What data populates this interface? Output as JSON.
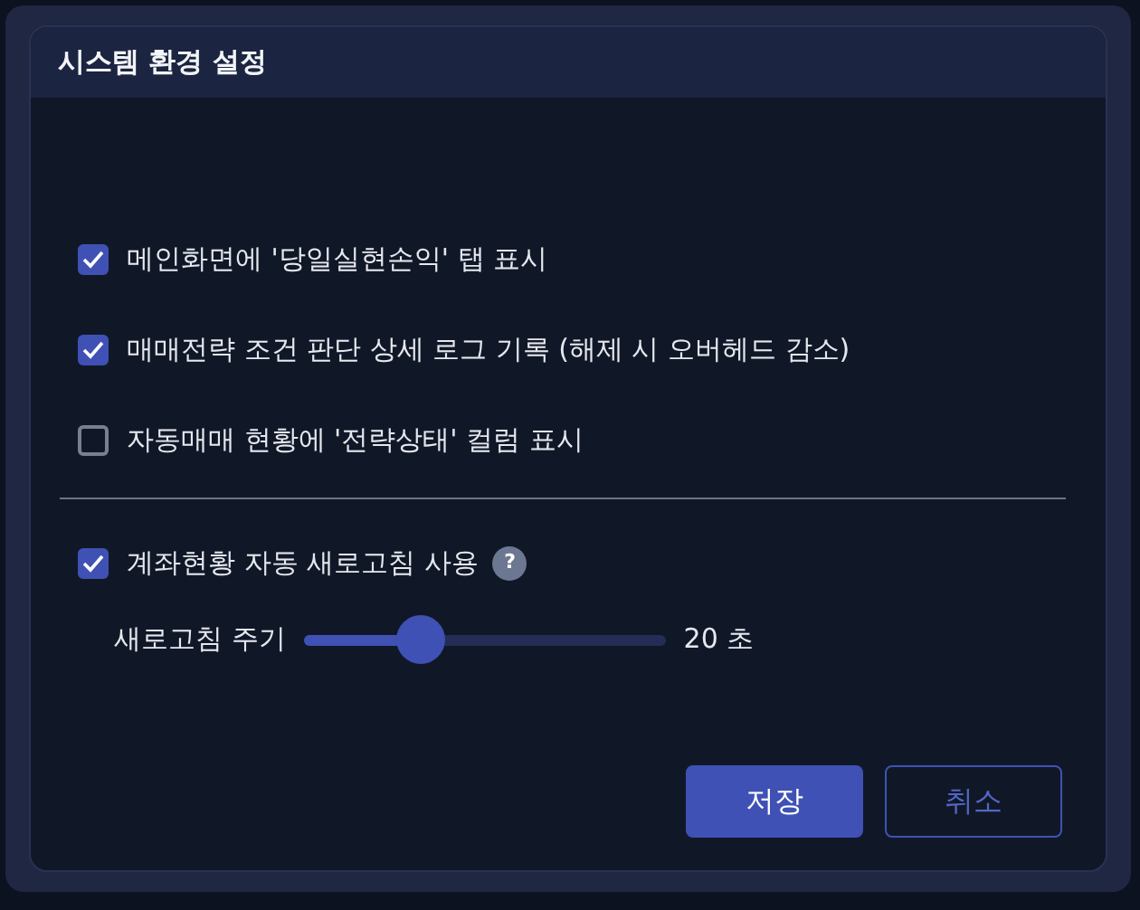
{
  "dialog": {
    "title": "시스템 환경 설정"
  },
  "options": [
    {
      "label": "메인화면에 '당일실현손익' 탭 표시",
      "checked": true
    },
    {
      "label": "매매전략 조건 판단 상세 로그 기록 (해제 시 오버헤드 감소)",
      "checked": true
    },
    {
      "label": "자동매매 현황에 '전략상태' 컬럼 표시",
      "checked": false
    }
  ],
  "auto_refresh": {
    "label": "계좌현황 자동 새로고침 사용",
    "checked": true,
    "help": "?",
    "interval_label": "새로고침 주기",
    "level": 0.32,
    "reading": "20 초"
  },
  "buttons": [
    {
      "label": "저장",
      "kind": "primary"
    },
    {
      "label": "취소",
      "kind": "secondary"
    }
  ]
}
